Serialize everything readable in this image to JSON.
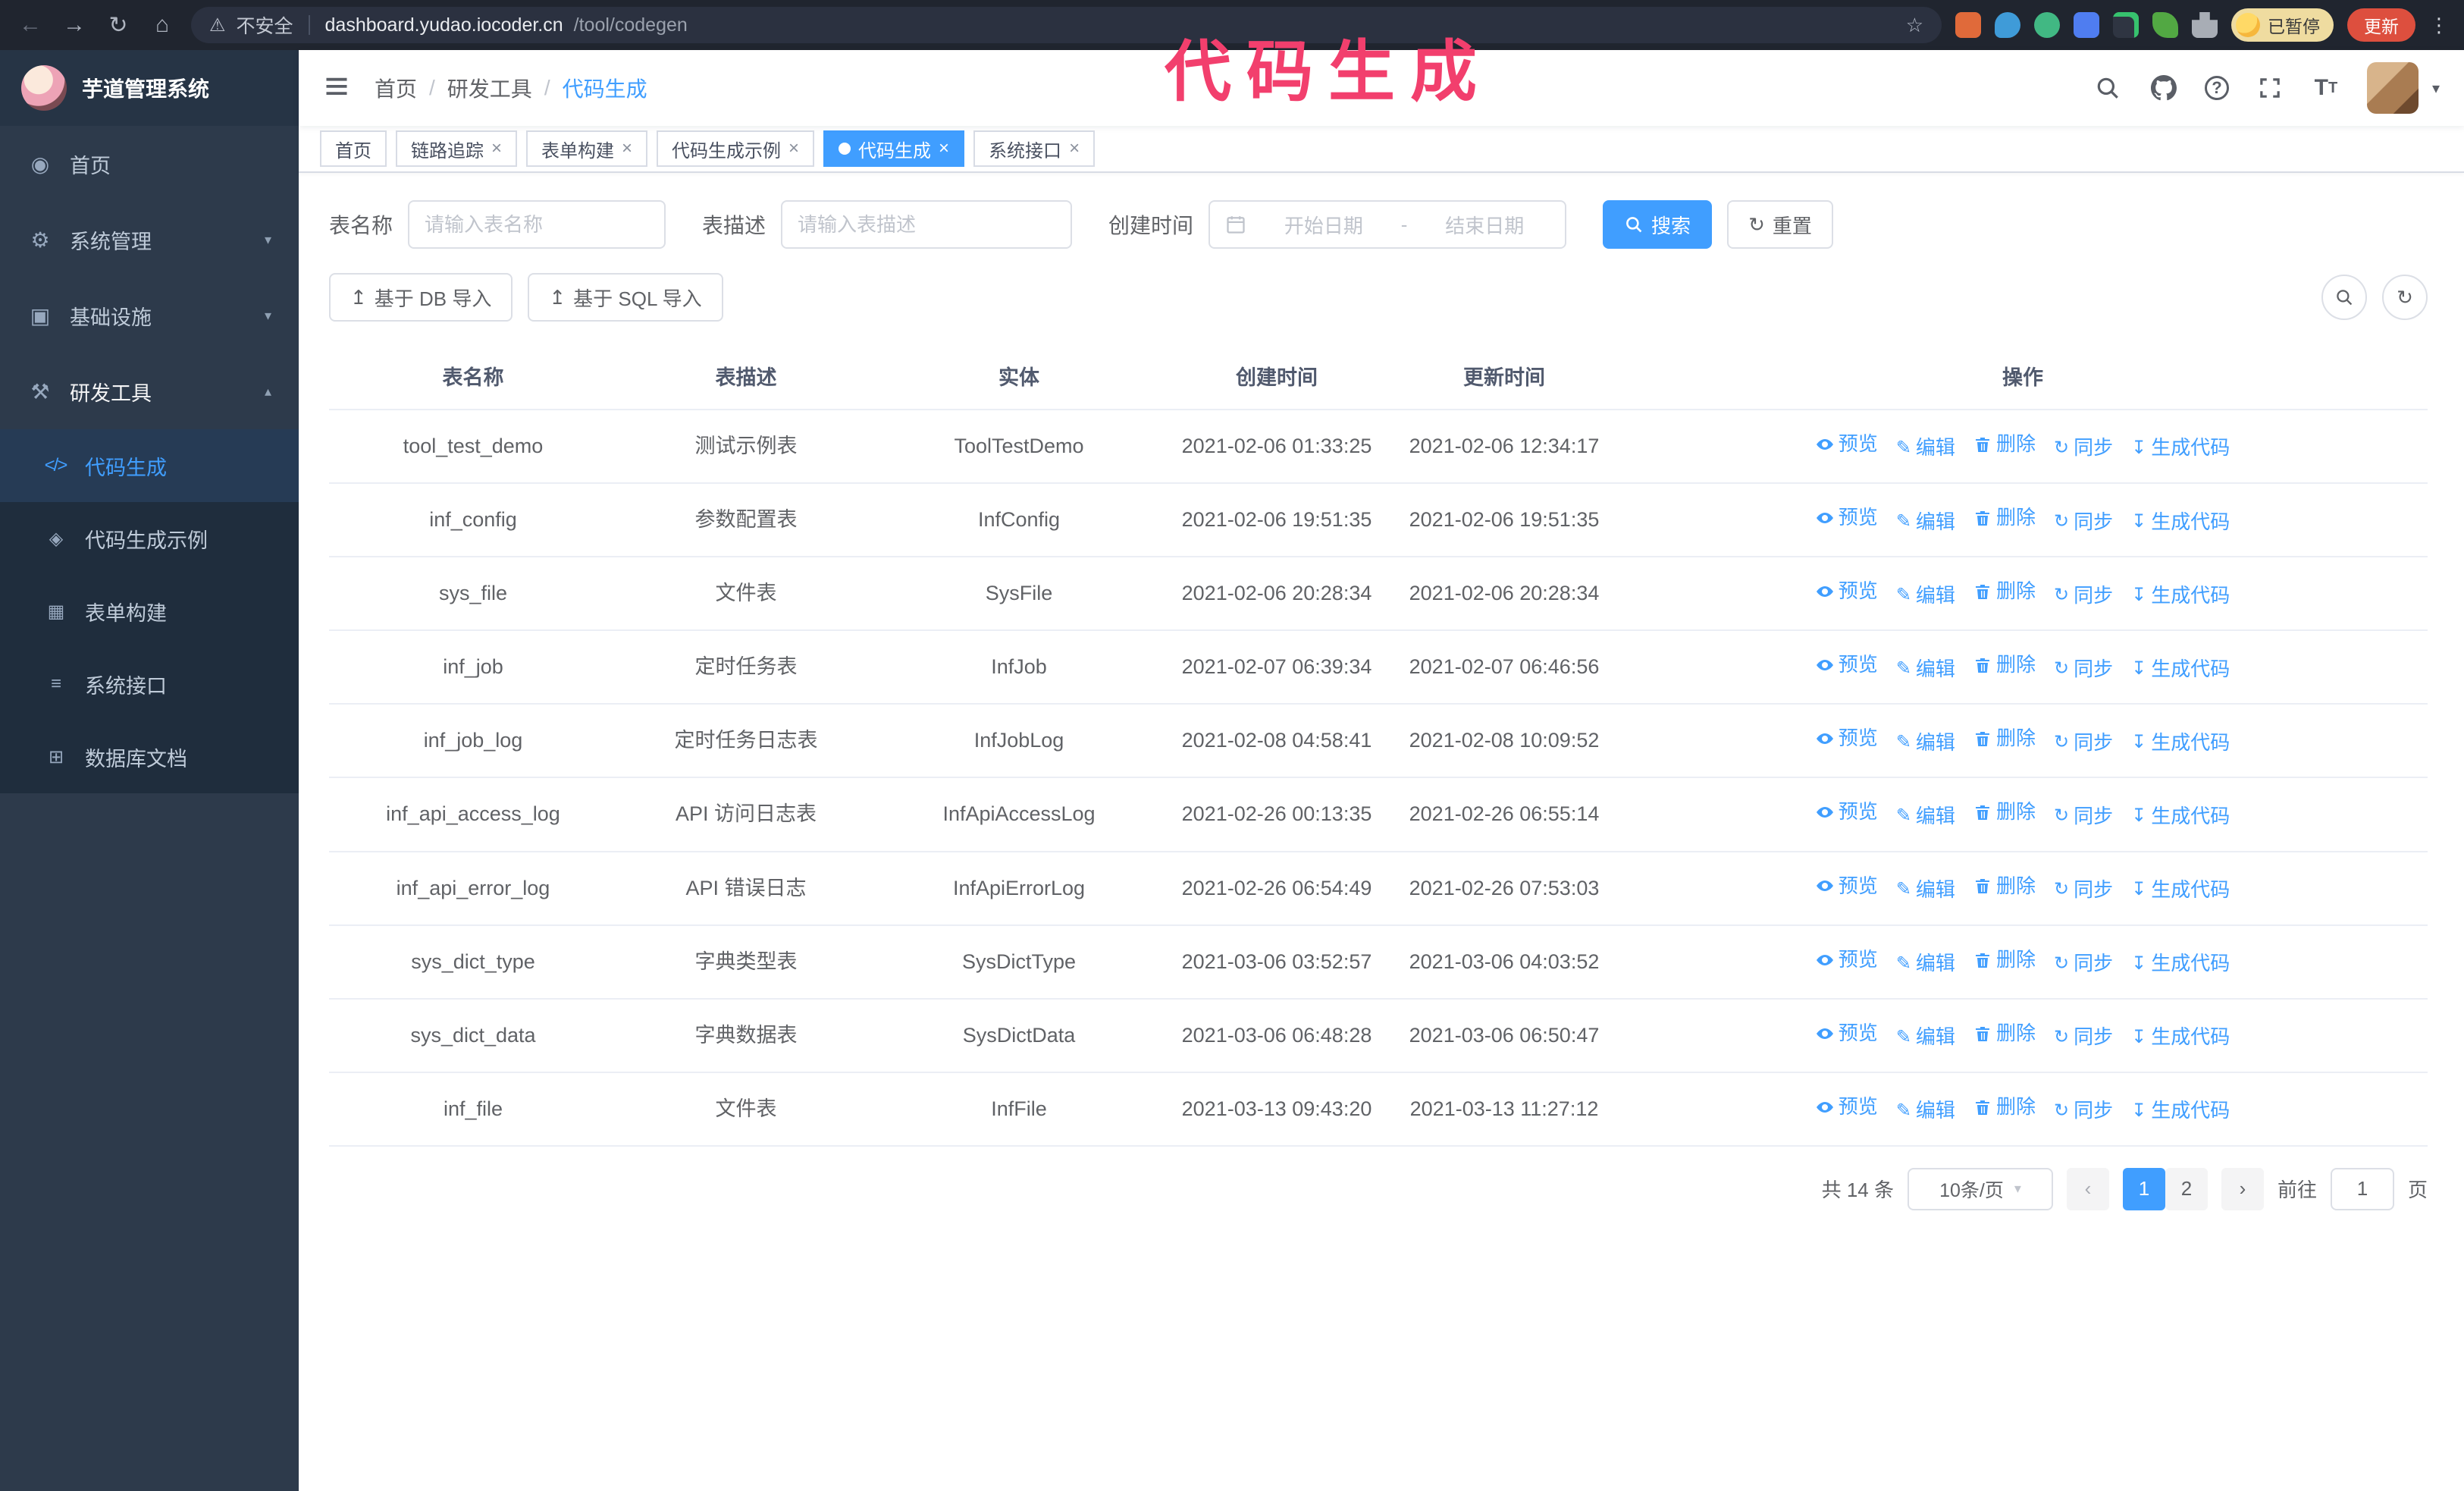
{
  "annotation": {
    "text": "代码生成",
    "color": "#f23f6d"
  },
  "browser": {
    "security_label": "不安全",
    "url_host": "dashboard.yudao.iocoder.cn",
    "url_path": "/tool/codegen",
    "paused_badge": "已暂停",
    "update_button": "更新"
  },
  "icons": {
    "back": "←",
    "forward": "→",
    "reload": "↻",
    "home": "⌂",
    "warning": "⚠",
    "star": "☆",
    "kebab": "⋮",
    "close": "×",
    "caret_down": "▾",
    "caret_up": "▴",
    "reset": "↻",
    "import": "↥",
    "prev": "‹",
    "next": "›",
    "help": "?",
    "font_size": "T",
    "breadcrumb_sep": "/"
  },
  "sidebar": {
    "app_title": "芋道管理系统",
    "items": [
      {
        "label": "首页",
        "icon_glyph": "◉"
      },
      {
        "label": "系统管理",
        "icon_glyph": "⚙"
      },
      {
        "label": "基础设施",
        "icon_glyph": "▣"
      },
      {
        "label": "研发工具",
        "icon_glyph": "⚒"
      }
    ],
    "subitems": [
      {
        "label": "代码生成",
        "icon_glyph": "</>"
      },
      {
        "label": "代码生成示例",
        "icon_glyph": "◈"
      },
      {
        "label": "表单构建",
        "icon_glyph": "▦"
      },
      {
        "label": "系统接口",
        "icon_glyph": "≡"
      },
      {
        "label": "数据库文档",
        "icon_glyph": "⊞"
      }
    ]
  },
  "breadcrumb": [
    "首页",
    "研发工具",
    "代码生成"
  ],
  "tabs": [
    {
      "label": "首页"
    },
    {
      "label": "链路追踪"
    },
    {
      "label": "表单构建"
    },
    {
      "label": "代码生成示例"
    },
    {
      "label": "代码生成"
    },
    {
      "label": "系统接口"
    }
  ],
  "filters": {
    "table_name_label": "表名称",
    "table_name_placeholder": "请输入表名称",
    "table_desc_label": "表描述",
    "table_desc_placeholder": "请输入表描述",
    "create_time_label": "创建时间",
    "start_date_placeholder": "开始日期",
    "range_separator": "-",
    "end_date_placeholder": "结束日期",
    "search_button": "搜索",
    "reset_button": "重置"
  },
  "toolbar": {
    "import_db": "基于 DB 导入",
    "import_sql": "基于 SQL 导入"
  },
  "table": {
    "headers": [
      "表名称",
      "表描述",
      "实体",
      "创建时间",
      "更新时间",
      "操作"
    ],
    "actions": [
      "预览",
      "编辑",
      "删除",
      "同步",
      "生成代码"
    ],
    "rows": [
      {
        "name": "tool_test_demo",
        "desc": "测试示例表",
        "entity": "ToolTestDemo",
        "created": "2021-02-06 01:33:25",
        "updated": "2021-02-06 12:34:17"
      },
      {
        "name": "inf_config",
        "desc": "参数配置表",
        "entity": "InfConfig",
        "created": "2021-02-06 19:51:35",
        "updated": "2021-02-06 19:51:35"
      },
      {
        "name": "sys_file",
        "desc": "文件表",
        "entity": "SysFile",
        "created": "2021-02-06 20:28:34",
        "updated": "2021-02-06 20:28:34"
      },
      {
        "name": "inf_job",
        "desc": "定时任务表",
        "entity": "InfJob",
        "created": "2021-02-07 06:39:34",
        "updated": "2021-02-07 06:46:56"
      },
      {
        "name": "inf_job_log",
        "desc": "定时任务日志表",
        "entity": "InfJobLog",
        "created": "2021-02-08 04:58:41",
        "updated": "2021-02-08 10:09:52"
      },
      {
        "name": "inf_api_access_log",
        "desc": "API 访问日志表",
        "entity": "InfApiAccessLog",
        "created": "2021-02-26 00:13:35",
        "updated": "2021-02-26 06:55:14"
      },
      {
        "name": "inf_api_error_log",
        "desc": "API 错误日志",
        "entity": "InfApiErrorLog",
        "created": "2021-02-26 06:54:49",
        "updated": "2021-02-26 07:53:03"
      },
      {
        "name": "sys_dict_type",
        "desc": "字典类型表",
        "entity": "SysDictType",
        "created": "2021-03-06 03:52:57",
        "updated": "2021-03-06 04:03:52"
      },
      {
        "name": "sys_dict_data",
        "desc": "字典数据表",
        "entity": "SysDictData",
        "created": "2021-03-06 06:48:28",
        "updated": "2021-03-06 06:50:47"
      },
      {
        "name": "inf_file",
        "desc": "文件表",
        "entity": "InfFile",
        "created": "2021-03-13 09:43:20",
        "updated": "2021-03-13 11:27:12"
      }
    ]
  },
  "pagination": {
    "total": "共 14 条",
    "page_size": "10条/页",
    "pages": [
      "1",
      "2"
    ],
    "active_page": "1",
    "goto_label": "前往",
    "goto_value": "1",
    "goto_suffix": "页"
  }
}
